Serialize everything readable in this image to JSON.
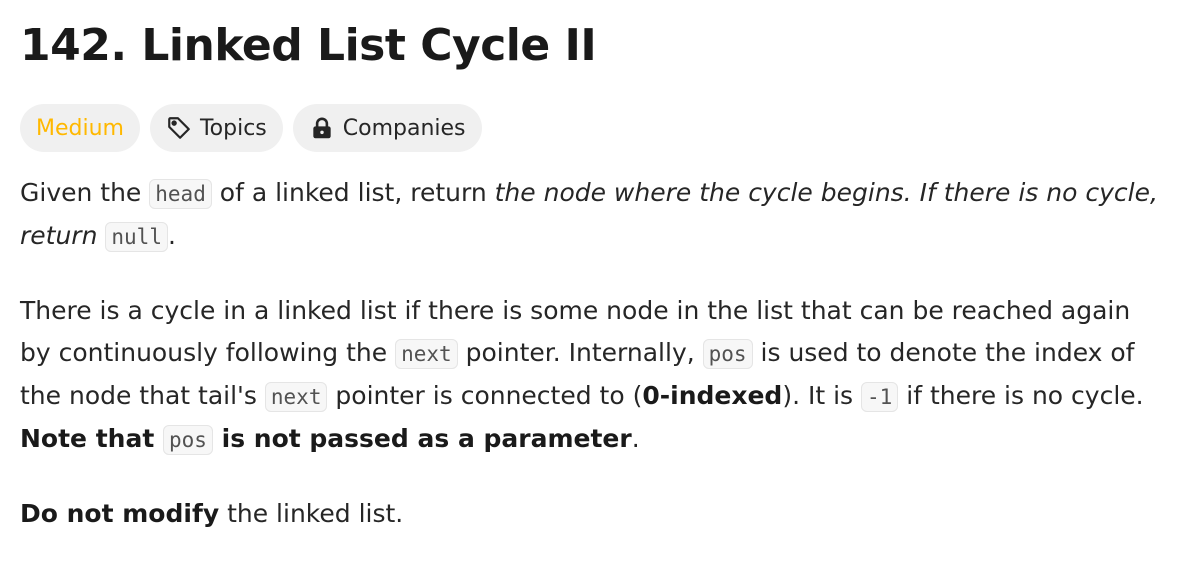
{
  "problem": {
    "title": "142. Linked List Cycle II"
  },
  "tags": {
    "difficulty": "Medium",
    "topics": "Topics",
    "companies": "Companies"
  },
  "description": {
    "p1": {
      "t1": "Given the ",
      "c1": "head",
      "t2": " of a linked list, return ",
      "i1": "the node where the cycle begins. If there is no cycle, return ",
      "c2": "null",
      "t3": "."
    },
    "p2": {
      "t1": "There is a cycle in a linked list if there is some node in the list that can be reached again by continuously following the ",
      "c1": "next",
      "t2": " pointer. Internally, ",
      "c2": "pos",
      "t3": " is used to denote the index of the node that tail's ",
      "c3": "next",
      "t4": " pointer is connected to (",
      "b1": "0-indexed",
      "t5": "). It is ",
      "c4": "-1",
      "t6": " if there is no cycle. ",
      "b2": "Note that ",
      "c5": "pos",
      "b3": " is not passed as a parameter",
      "t7": "."
    },
    "p3": {
      "b1": "Do not modify",
      "t1": " the linked list."
    }
  }
}
